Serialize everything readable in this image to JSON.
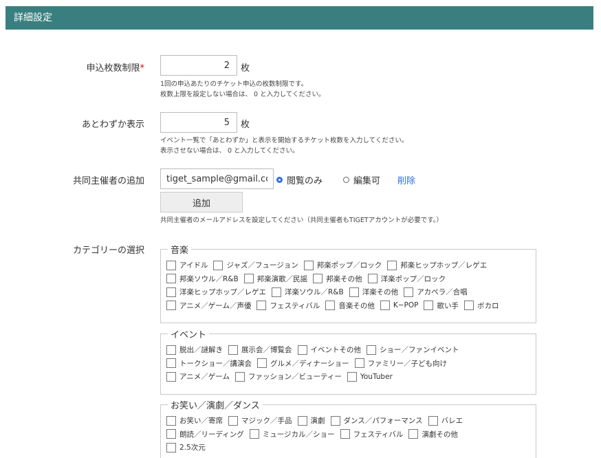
{
  "header": {
    "title": "詳細設定"
  },
  "limit": {
    "label": "申込枚数制限",
    "required": "*",
    "value": "2",
    "unit": "枚",
    "help1": "1回の申込あたりのチケット申込の枚数制限です。",
    "help2": "枚数上限を設定しない場合は、 0 と入力してください。"
  },
  "remaining": {
    "label": "あとわずか表示",
    "value": "5",
    "unit": "枚",
    "help1": "イベント一覧で「あとわずか」と表示を開始するチケット枚数を入力してください。",
    "help2": "表示させない場合は、 0 と入力してください。"
  },
  "coorganizer": {
    "label": "共同主催者の追加",
    "email": "tiget_sample@gmail.com",
    "radio_view": "閲覧のみ",
    "radio_edit": "編集可",
    "delete": "削除",
    "add": "追加",
    "help": "共同主催者のメールアドレスを設定してください（共同主催者もTIGETアカウントが必要です。）"
  },
  "category": {
    "label": "カテゴリーの選択",
    "groups": [
      {
        "legend": "音楽",
        "rows": [
          [
            "アイドル",
            "ジャズ／フュージョン",
            "邦楽ポップ／ロック",
            "邦楽ヒップホップ／レゲエ"
          ],
          [
            "邦楽ソウル／R&B",
            "邦楽演歌／民謡",
            "邦楽その他",
            "洋楽ポップ／ロック"
          ],
          [
            "洋楽ヒップホップ／レゲエ",
            "洋楽ソウル／R&B",
            "洋楽その他",
            "アカペラ／合唱"
          ],
          [
            "アニメ／ゲーム／声優",
            "フェスティバル",
            "音楽その他",
            "K−POP",
            "歌い手",
            "ボカロ"
          ]
        ]
      },
      {
        "legend": "イベント",
        "rows": [
          [
            "脱出／謎解き",
            "展示会／博覧会",
            "イベントその他",
            "ショー／ファンイベント"
          ],
          [
            "トークショー／講演会",
            "グルメ／ディナーショー",
            "ファミリー／子ども向け"
          ],
          [
            "アニメ／ゲーム",
            "ファッション／ビューティー",
            "YouTuber"
          ]
        ]
      },
      {
        "legend": "お笑い／演劇／ダンス",
        "rows": [
          [
            "お笑い／寄席",
            "マジック／手品",
            "演劇",
            "ダンス／パフォーマンス",
            "バレエ"
          ],
          [
            "朗読／リーディング",
            "ミュージカル／ショー",
            "フェスティバル",
            "演劇その他"
          ],
          [
            "2.5次元"
          ]
        ]
      }
    ]
  }
}
